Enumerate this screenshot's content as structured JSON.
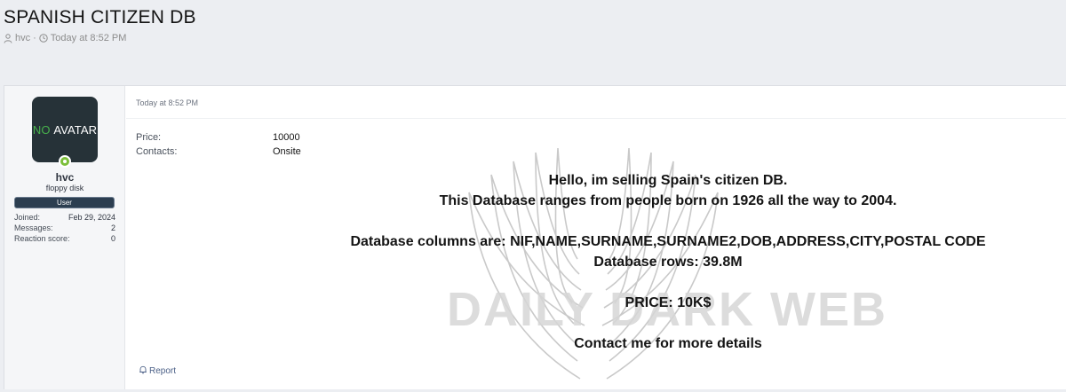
{
  "thread": {
    "title": "SPANISH CITIZEN DB",
    "author": "hvc",
    "separator": "·",
    "time": "Today at 8:52 PM"
  },
  "user": {
    "avatar_no": "NO",
    "avatar_rest": "AVATAR",
    "name": "hvc",
    "title": "floppy disk",
    "badge": "User",
    "stats": [
      {
        "label": "Joined:",
        "value": "Feb 29, 2024"
      },
      {
        "label": "Messages:",
        "value": "2"
      },
      {
        "label": "Reaction score:",
        "value": "0"
      }
    ]
  },
  "post": {
    "date": "Today at 8:52 PM",
    "fields": {
      "price_label": "Price:",
      "price_value": "10000",
      "contacts_label": "Contacts:",
      "contacts_value": "Onsite"
    },
    "message": {
      "line1": "Hello, im selling Spain's citizen DB.",
      "line2": "This Database ranges from people born on 1926 all the way to 2004.",
      "line3": "Database columns are: NIF,NAME,SURNAME,SURNAME2,DOB,ADDRESS,CITY,POSTAL CODE",
      "line4": "Database rows: 39.8M",
      "line5": "PRICE: 10K$",
      "line6": "Contact me for more details"
    },
    "report": "Report"
  },
  "watermark": {
    "text": "DAILY DARK WEB"
  },
  "colors": {
    "background": "#eceef2",
    "avatar_bg": "#263238",
    "avatar_no": "#47b04b",
    "online": "#7cbf3a",
    "badge_bg": "#2c3e50",
    "link": "#4a5f86"
  },
  "icons": {
    "author": "user-icon",
    "time": "clock-icon",
    "report": "bell-icon"
  }
}
